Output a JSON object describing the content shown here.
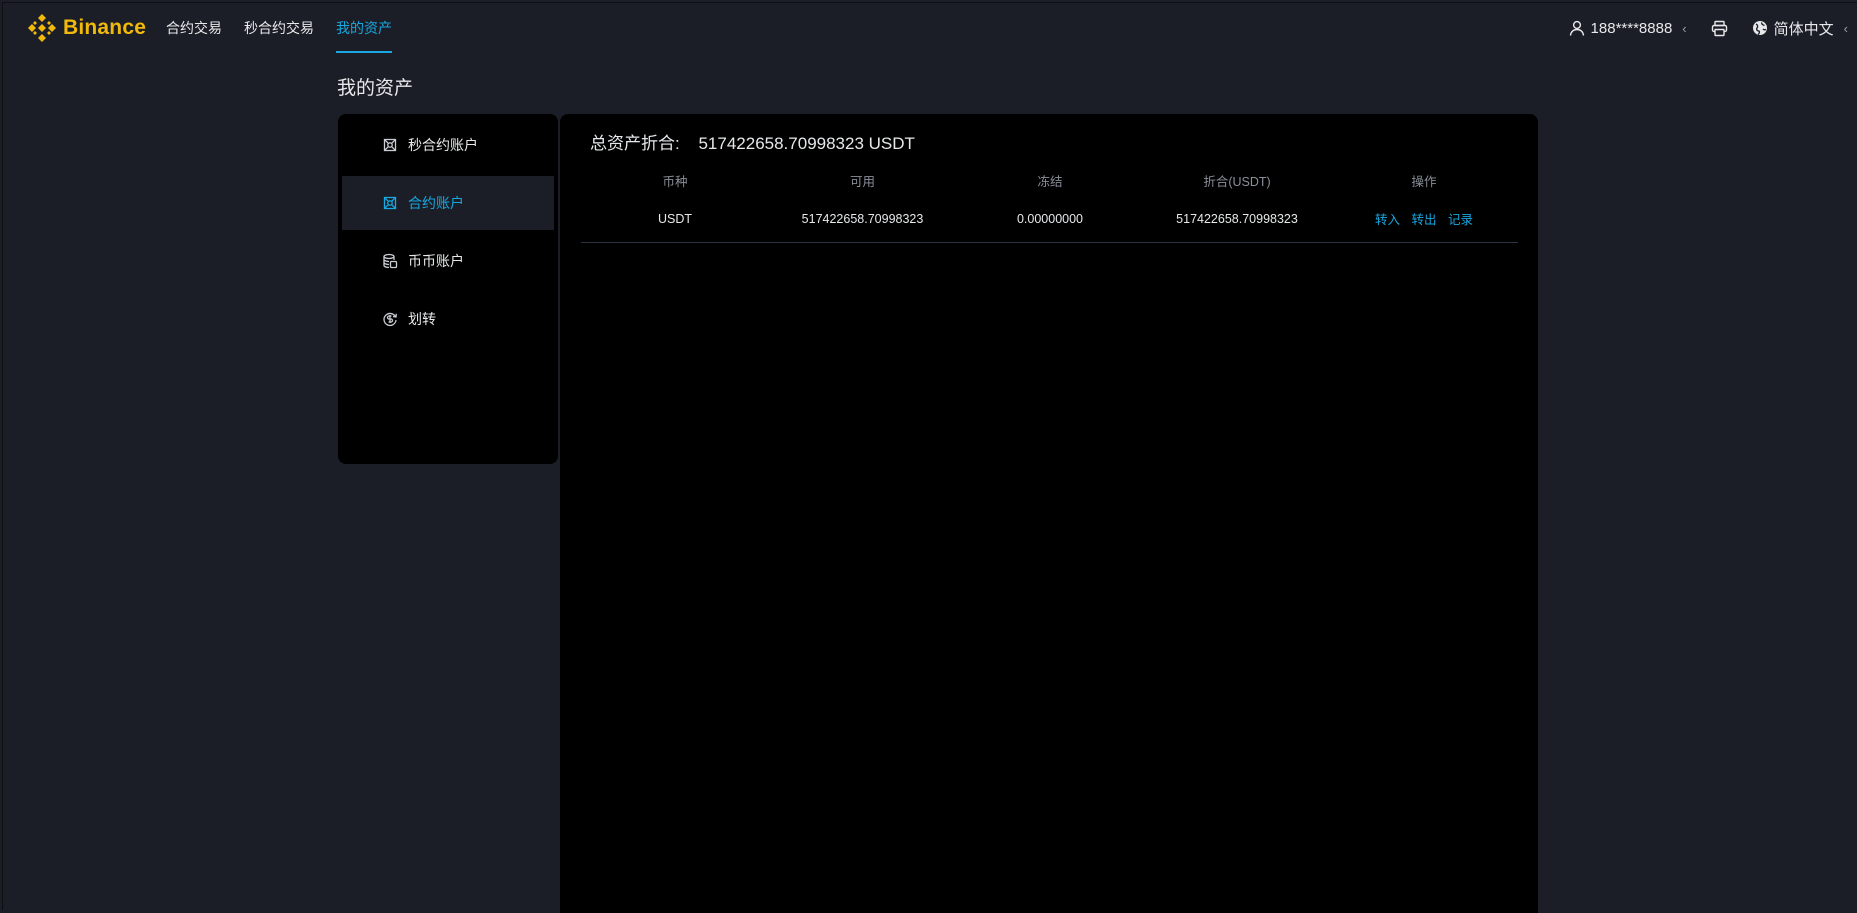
{
  "brand": {
    "name": "Binance",
    "color": "#f0b90b",
    "accent": "#18a7e0"
  },
  "nav": [
    {
      "label": "合约交易",
      "active": false
    },
    {
      "label": "秒合约交易",
      "active": false
    },
    {
      "label": "我的资产",
      "active": true
    }
  ],
  "header_right": {
    "user": "188****8888",
    "user_icon": "user-icon",
    "printer_icon": "printer-icon",
    "language": "简体中文",
    "language_icon": "globe-icon"
  },
  "page_title": "我的资产",
  "sidebar": {
    "items": [
      {
        "label": "秒合约账户",
        "icon": "contract-icon",
        "active": false
      },
      {
        "label": "合约账户",
        "icon": "contract-icon",
        "active": true
      },
      {
        "label": "币币账户",
        "icon": "coins-icon",
        "active": false
      },
      {
        "label": "划转",
        "icon": "transfer-icon",
        "active": false
      }
    ]
  },
  "summary": {
    "label": "总资产折合:",
    "value": "517422658.70998323 USDT"
  },
  "table": {
    "columns": [
      "币种",
      "可用",
      "冻结",
      "折合(USDT)",
      "操作"
    ],
    "rows": [
      {
        "currency": "USDT",
        "available": "517422658.70998323",
        "frozen": "0.00000000",
        "equivalent": "517422658.70998323",
        "actions": [
          "转入",
          "转出",
          "记录"
        ]
      }
    ]
  }
}
